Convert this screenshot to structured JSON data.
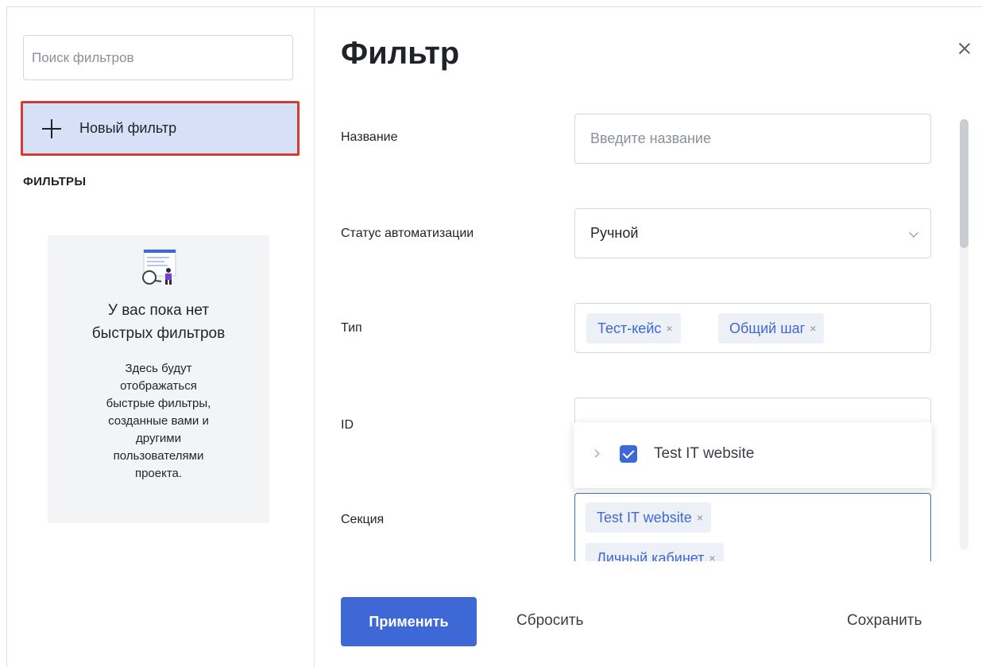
{
  "sidebar": {
    "search_placeholder": "Поиск фильтров",
    "new_filter_label": "Новый фильтр",
    "section_title": "ФИЛЬТРЫ",
    "empty_state": {
      "title_line1": "У вас пока нет",
      "title_line2": "быстрых фильтров",
      "text_lines": [
        "Здесь будут",
        "отображаться",
        "быстрые фильтры,",
        "созданные вами и",
        "другими",
        "пользователями",
        "проекта."
      ]
    }
  },
  "panel": {
    "title": "Фильтр",
    "fields": {
      "name": {
        "label": "Название",
        "placeholder": "Введите название"
      },
      "automation": {
        "label": "Статус автоматизации",
        "value": "Ручной"
      },
      "type": {
        "label": "Тип",
        "chips": [
          "Тест-кейс",
          "Общий шаг"
        ]
      },
      "id": {
        "label": "ID"
      },
      "section": {
        "label": "Секция",
        "chips": [
          "Test IT website",
          "Личный кабинет"
        ]
      }
    },
    "dropdown": {
      "item_label": "Test IT website",
      "checked": true
    },
    "chip_remove": "×"
  },
  "footer": {
    "apply": "Применить",
    "reset": "Сбросить",
    "save": "Сохранить"
  },
  "colors": {
    "accent": "#3d68d6",
    "highlight_border": "#d53c2f",
    "new_filter_bg": "#d6e1f8"
  },
  "icons": [
    "plus-icon",
    "close-icon",
    "chevron-down-icon",
    "chevron-right-icon",
    "checkbox-checked-icon",
    "empty-filters-illustration"
  ]
}
